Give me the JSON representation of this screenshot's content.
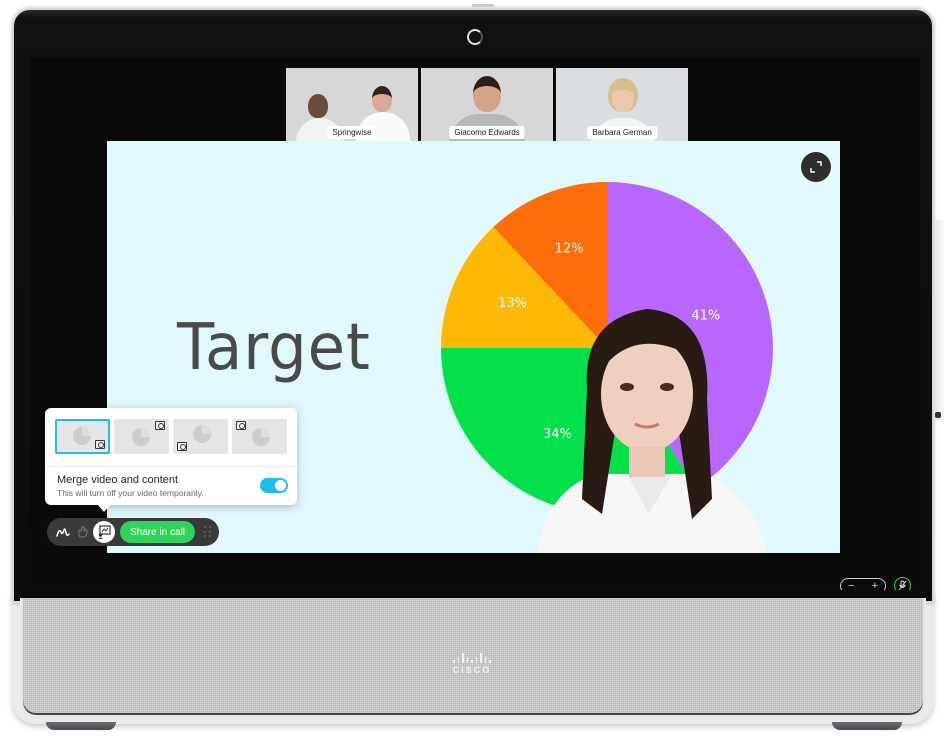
{
  "device": {
    "brand": "CISCO"
  },
  "participants": [
    {
      "name": "Springwise"
    },
    {
      "name": "Giacomo Edwards"
    },
    {
      "name": "Barbara German"
    }
  ],
  "slide": {
    "title": "Target",
    "expand_icon": "expand-icon"
  },
  "chart_data": {
    "type": "pie",
    "title": "Target",
    "start_angle": "12 o'clock",
    "direction": "clockwise",
    "slices": [
      {
        "label": "41%",
        "value": 41,
        "color": "#b866fc"
      },
      {
        "label": "34%",
        "value": 34,
        "color": "#04e04a"
      },
      {
        "label": "13%",
        "value": 13,
        "color": "#feb806"
      },
      {
        "label": "12%",
        "value": 12,
        "color": "#ff6d0a"
      }
    ]
  },
  "popup": {
    "layouts": [
      {
        "name": "pip-bottom-right",
        "selected": true
      },
      {
        "name": "pip-top-right",
        "selected": false
      },
      {
        "name": "pip-bottom-left",
        "selected": false
      },
      {
        "name": "pip-top-left",
        "selected": false
      }
    ],
    "merge_title": "Merge video and content",
    "merge_subtitle": "This will turn off your video temporarily.",
    "merge_toggle_on": true
  },
  "control_bar": {
    "annotate_icon": "pen-icon",
    "gesture_icon": "hand-icon",
    "share_mode_icon": "share-layout-icon",
    "share_label": "Share in call",
    "drag_icon": "drag-handle-icon"
  },
  "hardware": {
    "volume_down": "−",
    "volume_up": "+",
    "mute_icon": "mic-mute-icon"
  },
  "colors": {
    "accent": "#1ebdea",
    "share_green": "#2fd25a",
    "slide_bg": "#e1f9fd"
  }
}
